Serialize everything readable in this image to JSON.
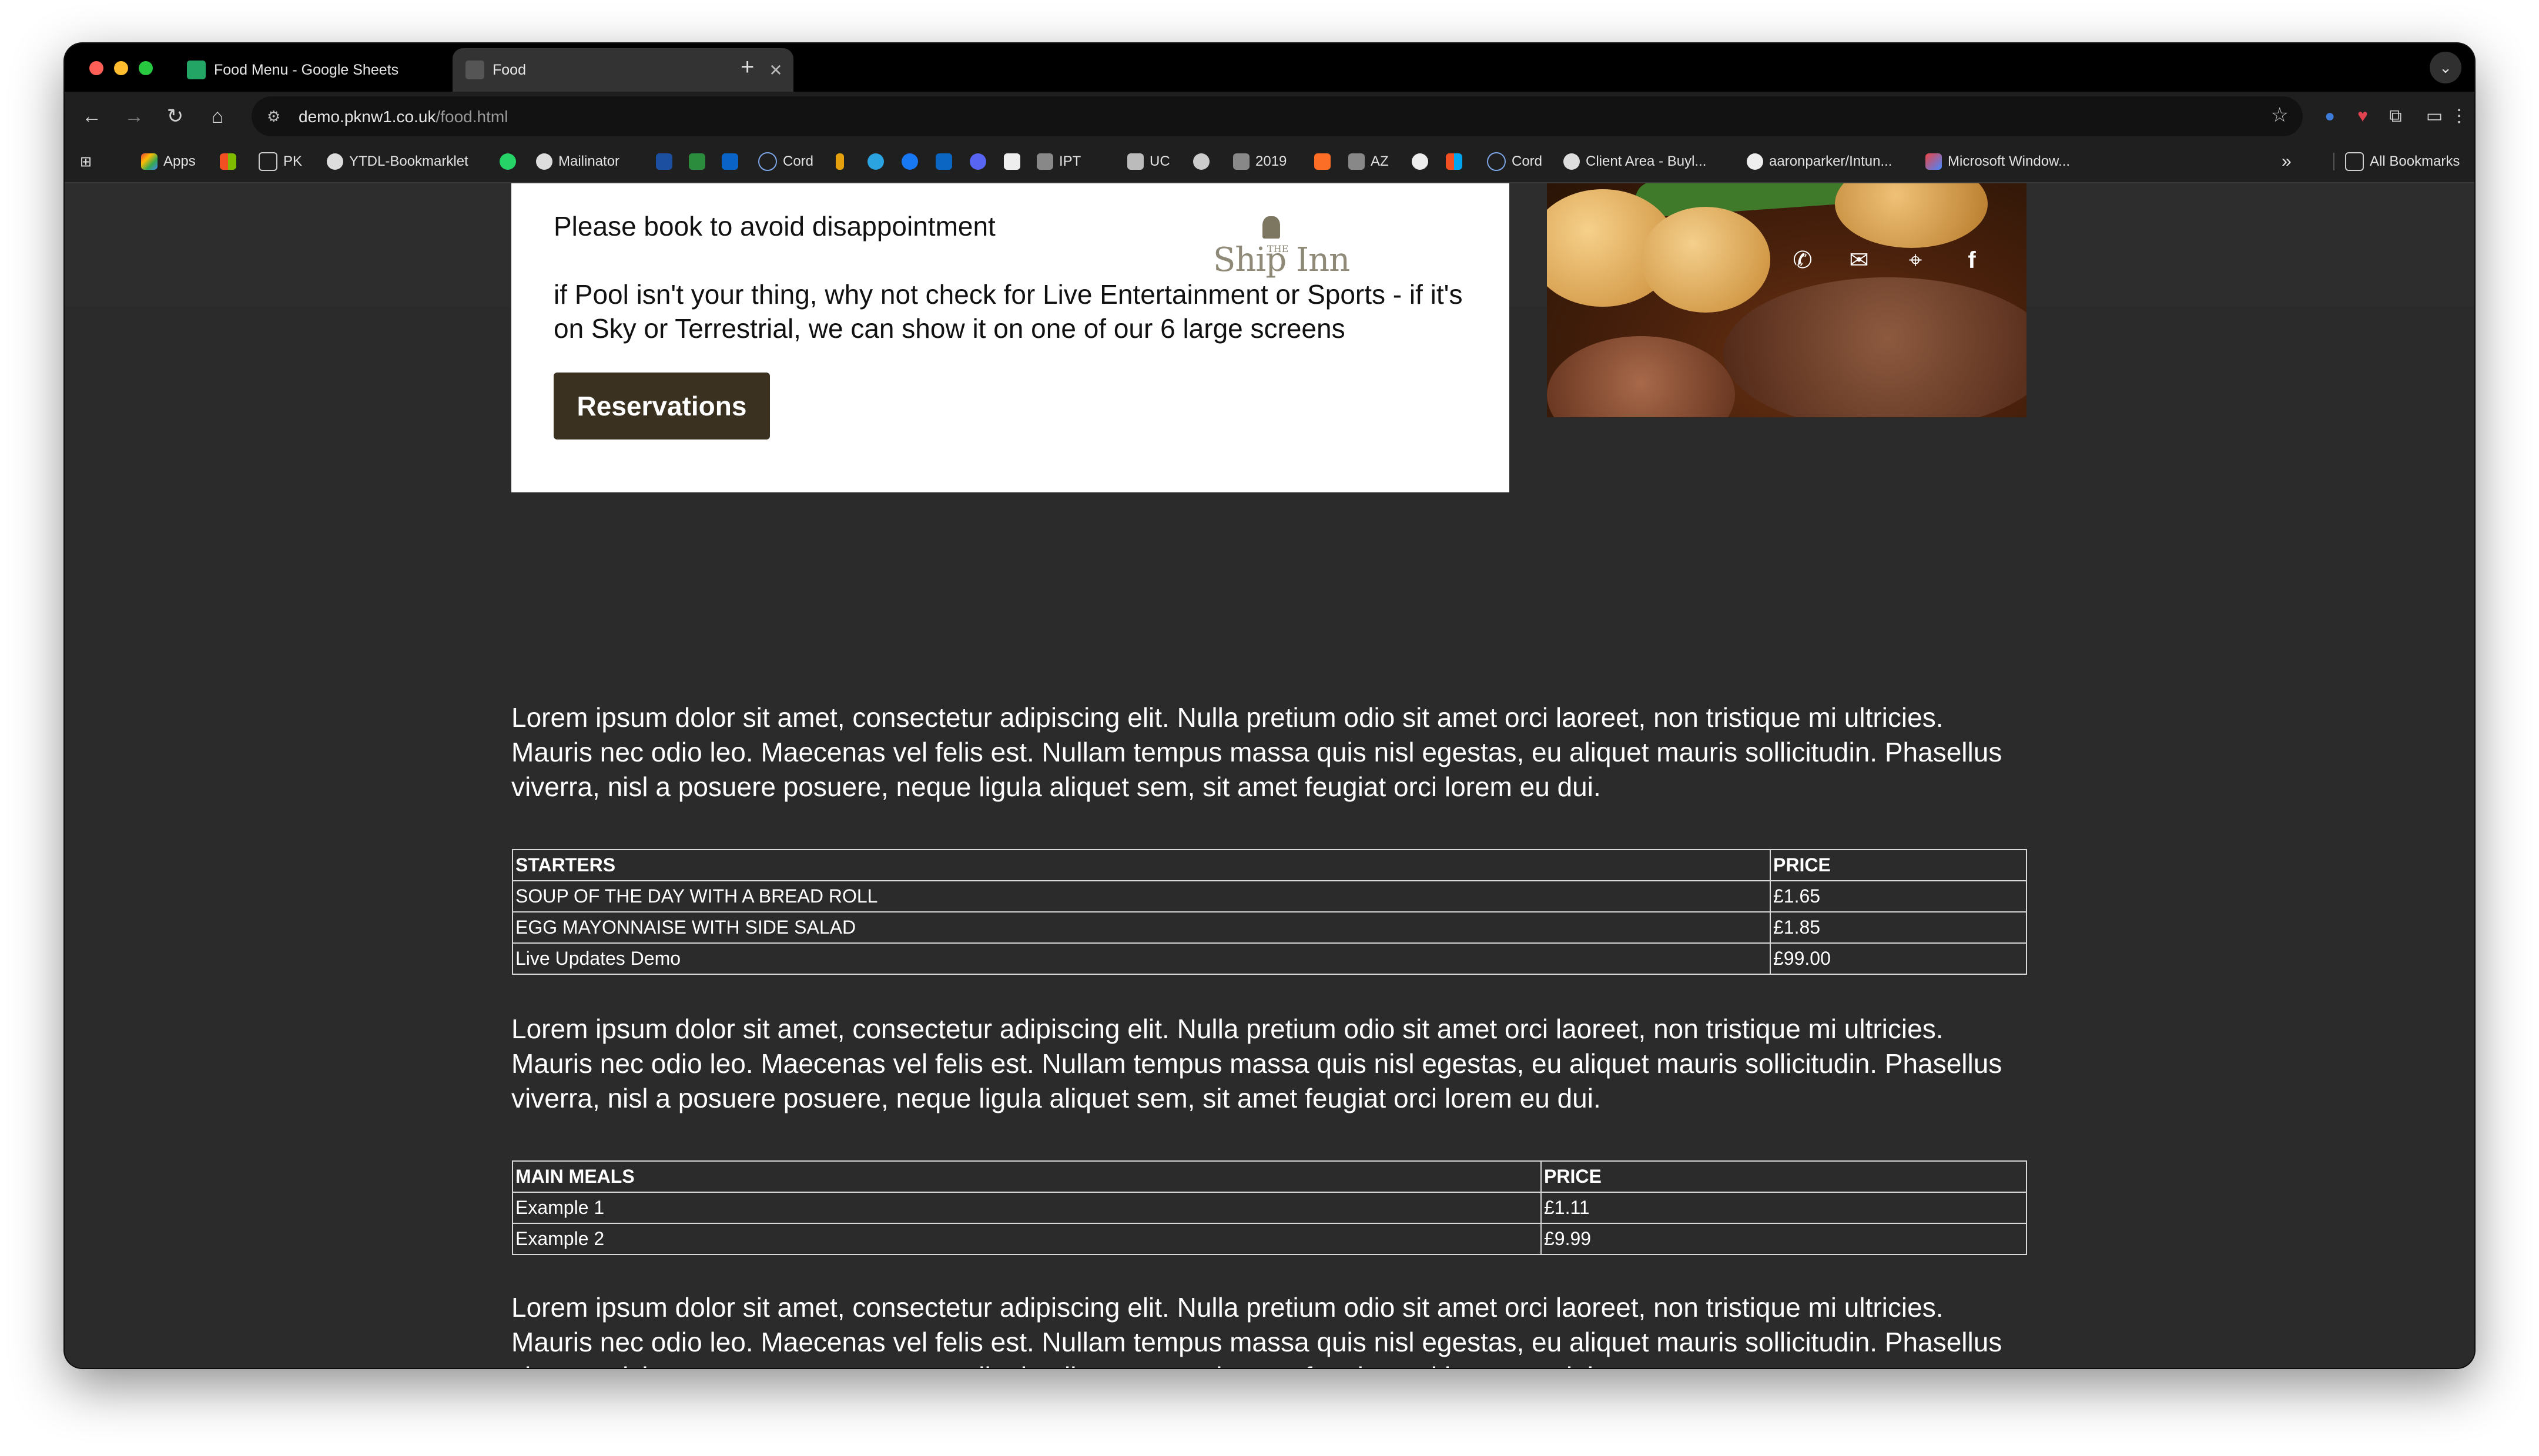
{
  "browser": {
    "tabs": [
      {
        "title": "Food Menu - Google Sheets",
        "active": false
      },
      {
        "title": "Food",
        "active": true
      }
    ],
    "new_tab": "+",
    "url_host": "demo.pknw1.co.uk",
    "url_path": "/food.html"
  },
  "bookmarks": {
    "items": [
      "Apps",
      "PK",
      "YTDL-Bookmarklet",
      "Mailinator",
      "Cord",
      "IPT",
      "UC",
      "2019",
      "AZ",
      "Cord",
      "Client Area - Buyl...",
      "aaronparker/Intun...",
      "Microsoft Window..."
    ],
    "overflow": "»",
    "all_bookmarks": "All Bookmarks"
  },
  "hero": {
    "book_text": "Please book to avoid disappointment",
    "pool_text": "if Pool isn't your thing, why not check for Live Entertainment or Sports - if it's on Sky or Terrestrial, we can show it on one of our 6 large screens",
    "reservations_label": "Reservations",
    "logo_the": "THE",
    "logo_text": "Ship Inn"
  },
  "body": {
    "lorem": "Lorem ipsum dolor sit amet, consectetur adipiscing elit. Nulla pretium odio sit amet orci laoreet, non tristique mi ultricies. Mauris nec odio leo. Maecenas vel felis est. Nullam tempus massa quis nisl egestas, eu aliquet mauris sollicitudin. Phasellus viverra, nisl a posuere posuere, neque ligula aliquet sem, sit amet feugiat orci lorem eu dui."
  },
  "starters": {
    "headers": [
      "STARTERS",
      "PRICE"
    ],
    "rows": [
      [
        "SOUP OF THE DAY WITH A BREAD ROLL",
        "£1.65"
      ],
      [
        "EGG MAYONNAISE WITH SIDE SALAD",
        "£1.85"
      ],
      [
        "Live Updates Demo",
        "£99.00"
      ]
    ]
  },
  "mains": {
    "headers": [
      "MAIN MEALS",
      "PRICE"
    ],
    "rows": [
      [
        "Example 1",
        "£1.11"
      ],
      [
        "Example 2",
        "£9.99"
      ]
    ]
  },
  "colors": {
    "page_bg": "#2b2b2b",
    "reservations_bg": "#3a3120",
    "logo": "#8f8a78"
  },
  "icons": [
    "phone-icon",
    "mail-icon",
    "location-pin-icon",
    "facebook-icon"
  ]
}
